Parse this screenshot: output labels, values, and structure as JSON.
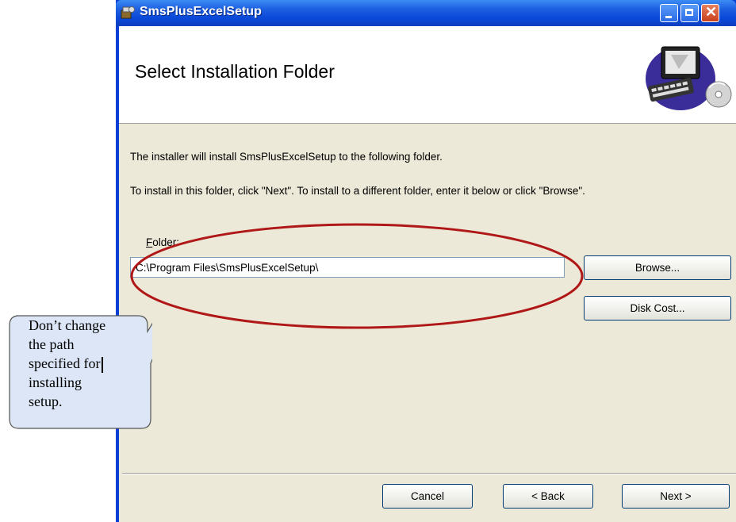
{
  "window": {
    "title": "SmsPlusExcelSetup"
  },
  "banner": {
    "heading": "Select Installation Folder",
    "graphic_icon": "computer-with-cd-icon"
  },
  "body": {
    "intro": "The installer will install SmsPlusExcelSetup to the following folder.",
    "instruction": "To install in this folder, click \"Next\". To install to a different folder, enter it below or click \"Browse\".",
    "folder_label_accel": "F",
    "folder_label_rest": "older:",
    "folder_path": "C:\\Program Files\\SmsPlusExcelSetup\\",
    "browse_label": "Browse...",
    "disk_cost_label": "Disk Cost..."
  },
  "footer": {
    "cancel_label": "Cancel",
    "back_label": "< Back",
    "next_label": "Next >"
  },
  "annotation": {
    "lines": [
      "Don’t change",
      "the path",
      "specified for",
      "installing",
      "setup."
    ],
    "highlight_color": "#b01818",
    "callout_fill": "#dde6f6"
  }
}
